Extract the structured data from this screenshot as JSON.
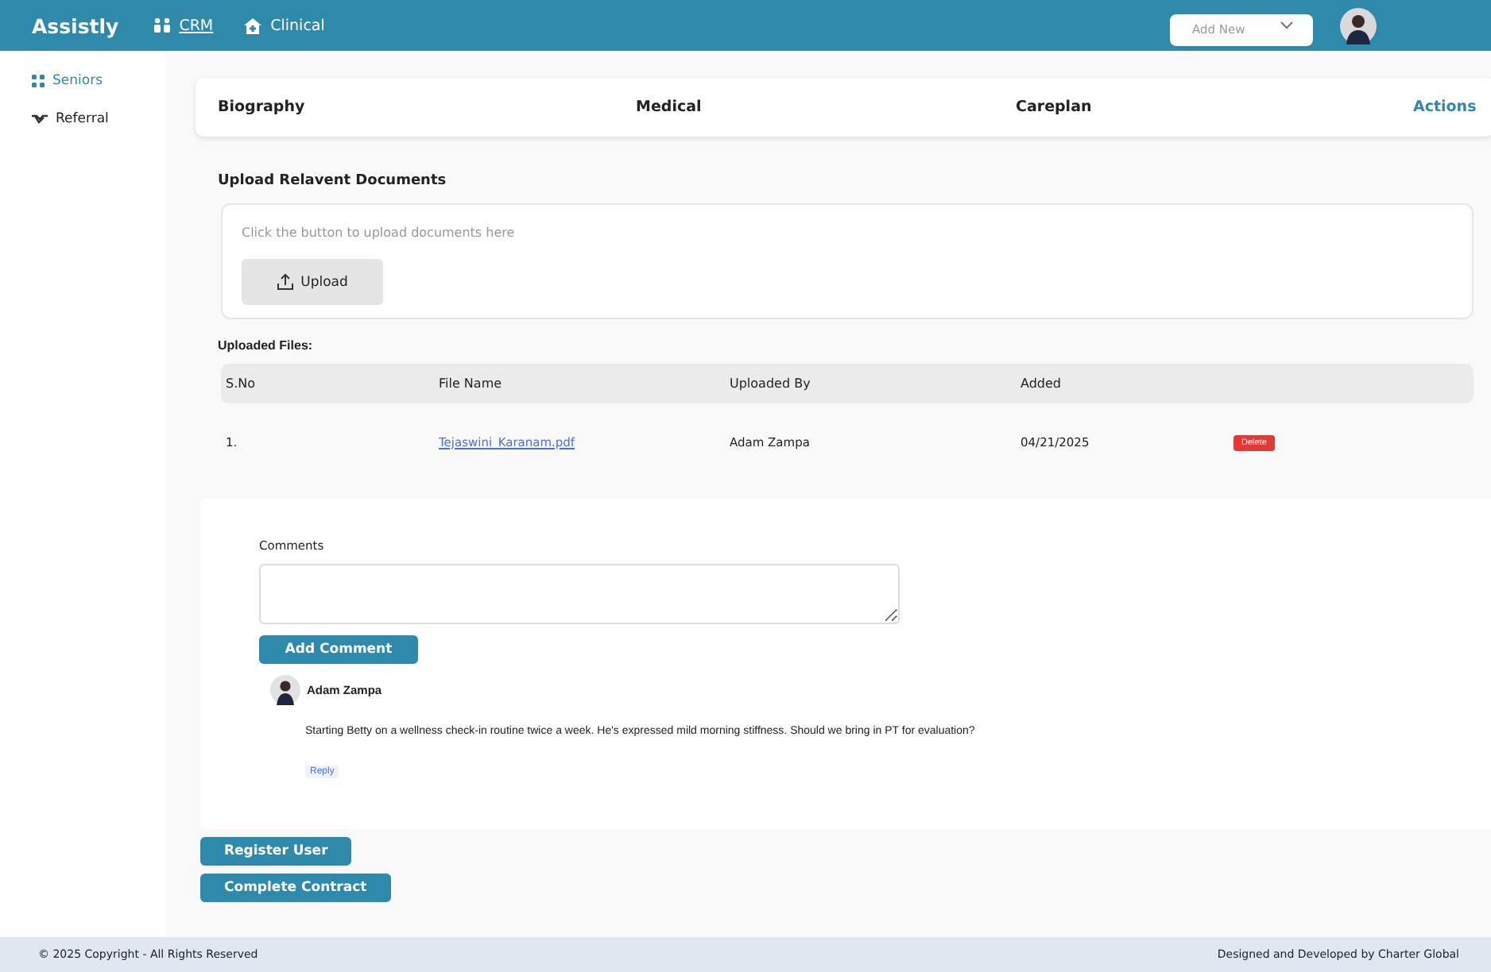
{
  "header": {
    "brand": "Assistly",
    "nav": [
      {
        "label": "CRM",
        "selected": true
      },
      {
        "label": "Clinical",
        "selected": false
      }
    ],
    "add_new": {
      "placeholder": "Add New"
    }
  },
  "sidebar": {
    "items": [
      {
        "label": "Seniors",
        "selected": true
      },
      {
        "label": "Referral",
        "selected": false
      }
    ]
  },
  "tabs": [
    {
      "label": "Biography",
      "selected": false
    },
    {
      "label": "Medical",
      "selected": false
    },
    {
      "label": "Careplan",
      "selected": false
    },
    {
      "label": "Actions",
      "selected": true
    }
  ],
  "upload": {
    "title": "Upload Relavent Documents",
    "hint": "Click the button to upload documents here",
    "button": "Upload"
  },
  "files": {
    "title": "Uploaded Files:",
    "columns": [
      "S.No",
      "File Name",
      "Uploaded By",
      "Added"
    ],
    "rows": [
      {
        "sno": "1.",
        "file_name": "Tejaswini_Karanam.pdf",
        "uploaded_by": "Adam Zampa",
        "added": "04/21/2025",
        "action": "Delete"
      }
    ]
  },
  "comments": {
    "label": "Comments",
    "button": "Add Comment",
    "items": [
      {
        "author": "Adam Zampa",
        "text": "Starting Betty on a wellness check-in routine twice a week. He's expressed mild morning stiffness. Should we bring in PT for evaluation?",
        "reply": "Reply"
      }
    ]
  },
  "actions": [
    "Register User",
    "Complete Contract"
  ],
  "footer": {
    "left": "© 2025 Copyright - All Rights Reserved",
    "right": "Designed and Developed by Charter Global"
  }
}
